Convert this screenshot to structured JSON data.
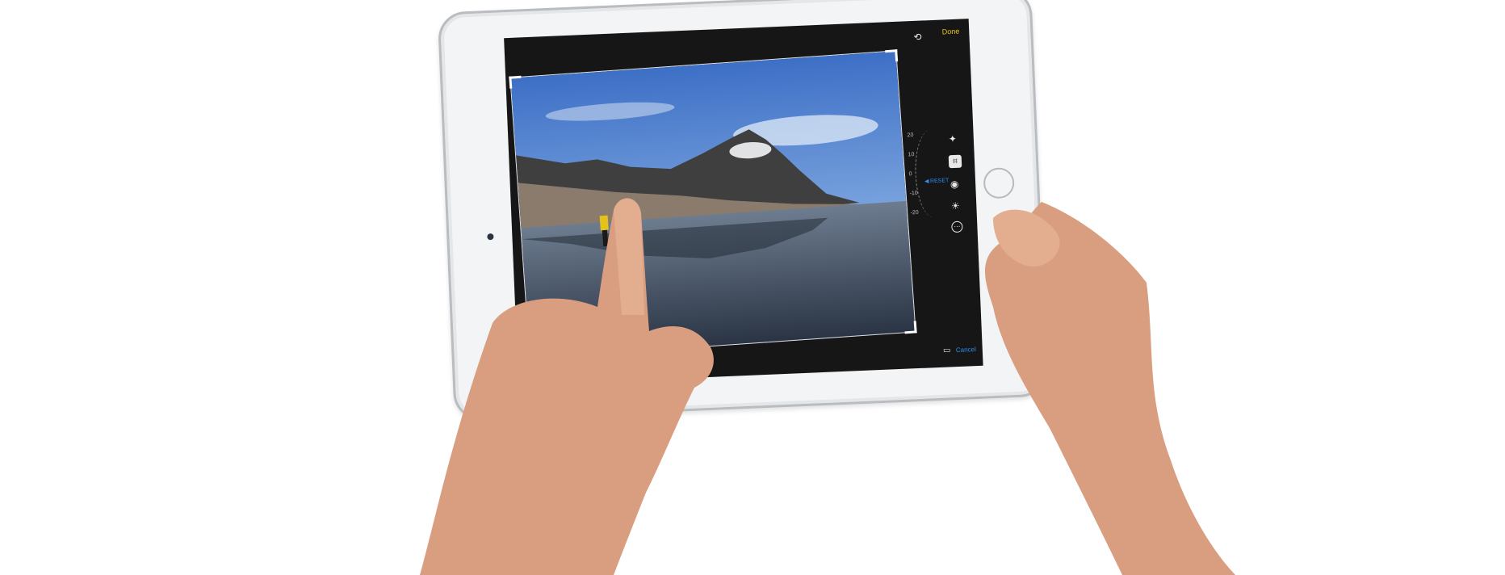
{
  "toolbar": {
    "done_label": "Done",
    "cancel_label": "Cancel",
    "reset_label": "RESET"
  },
  "straighten_dial": {
    "ticks": [
      "20",
      "10",
      "0",
      "-10",
      "-20"
    ]
  },
  "icons": {
    "rotate": "rotate-icon",
    "aspect": "aspect-ratio-icon",
    "auto_enhance": "magic-wand-icon",
    "crop": "crop-rotate-icon",
    "color": "color-filter-icon",
    "light": "light-adjust-icon",
    "more": "more-icon"
  },
  "colors": {
    "done": "#f7c61b",
    "accent": "#2d8cf0",
    "screen_bg": "#161616",
    "device_body": "#f3f4f5"
  }
}
